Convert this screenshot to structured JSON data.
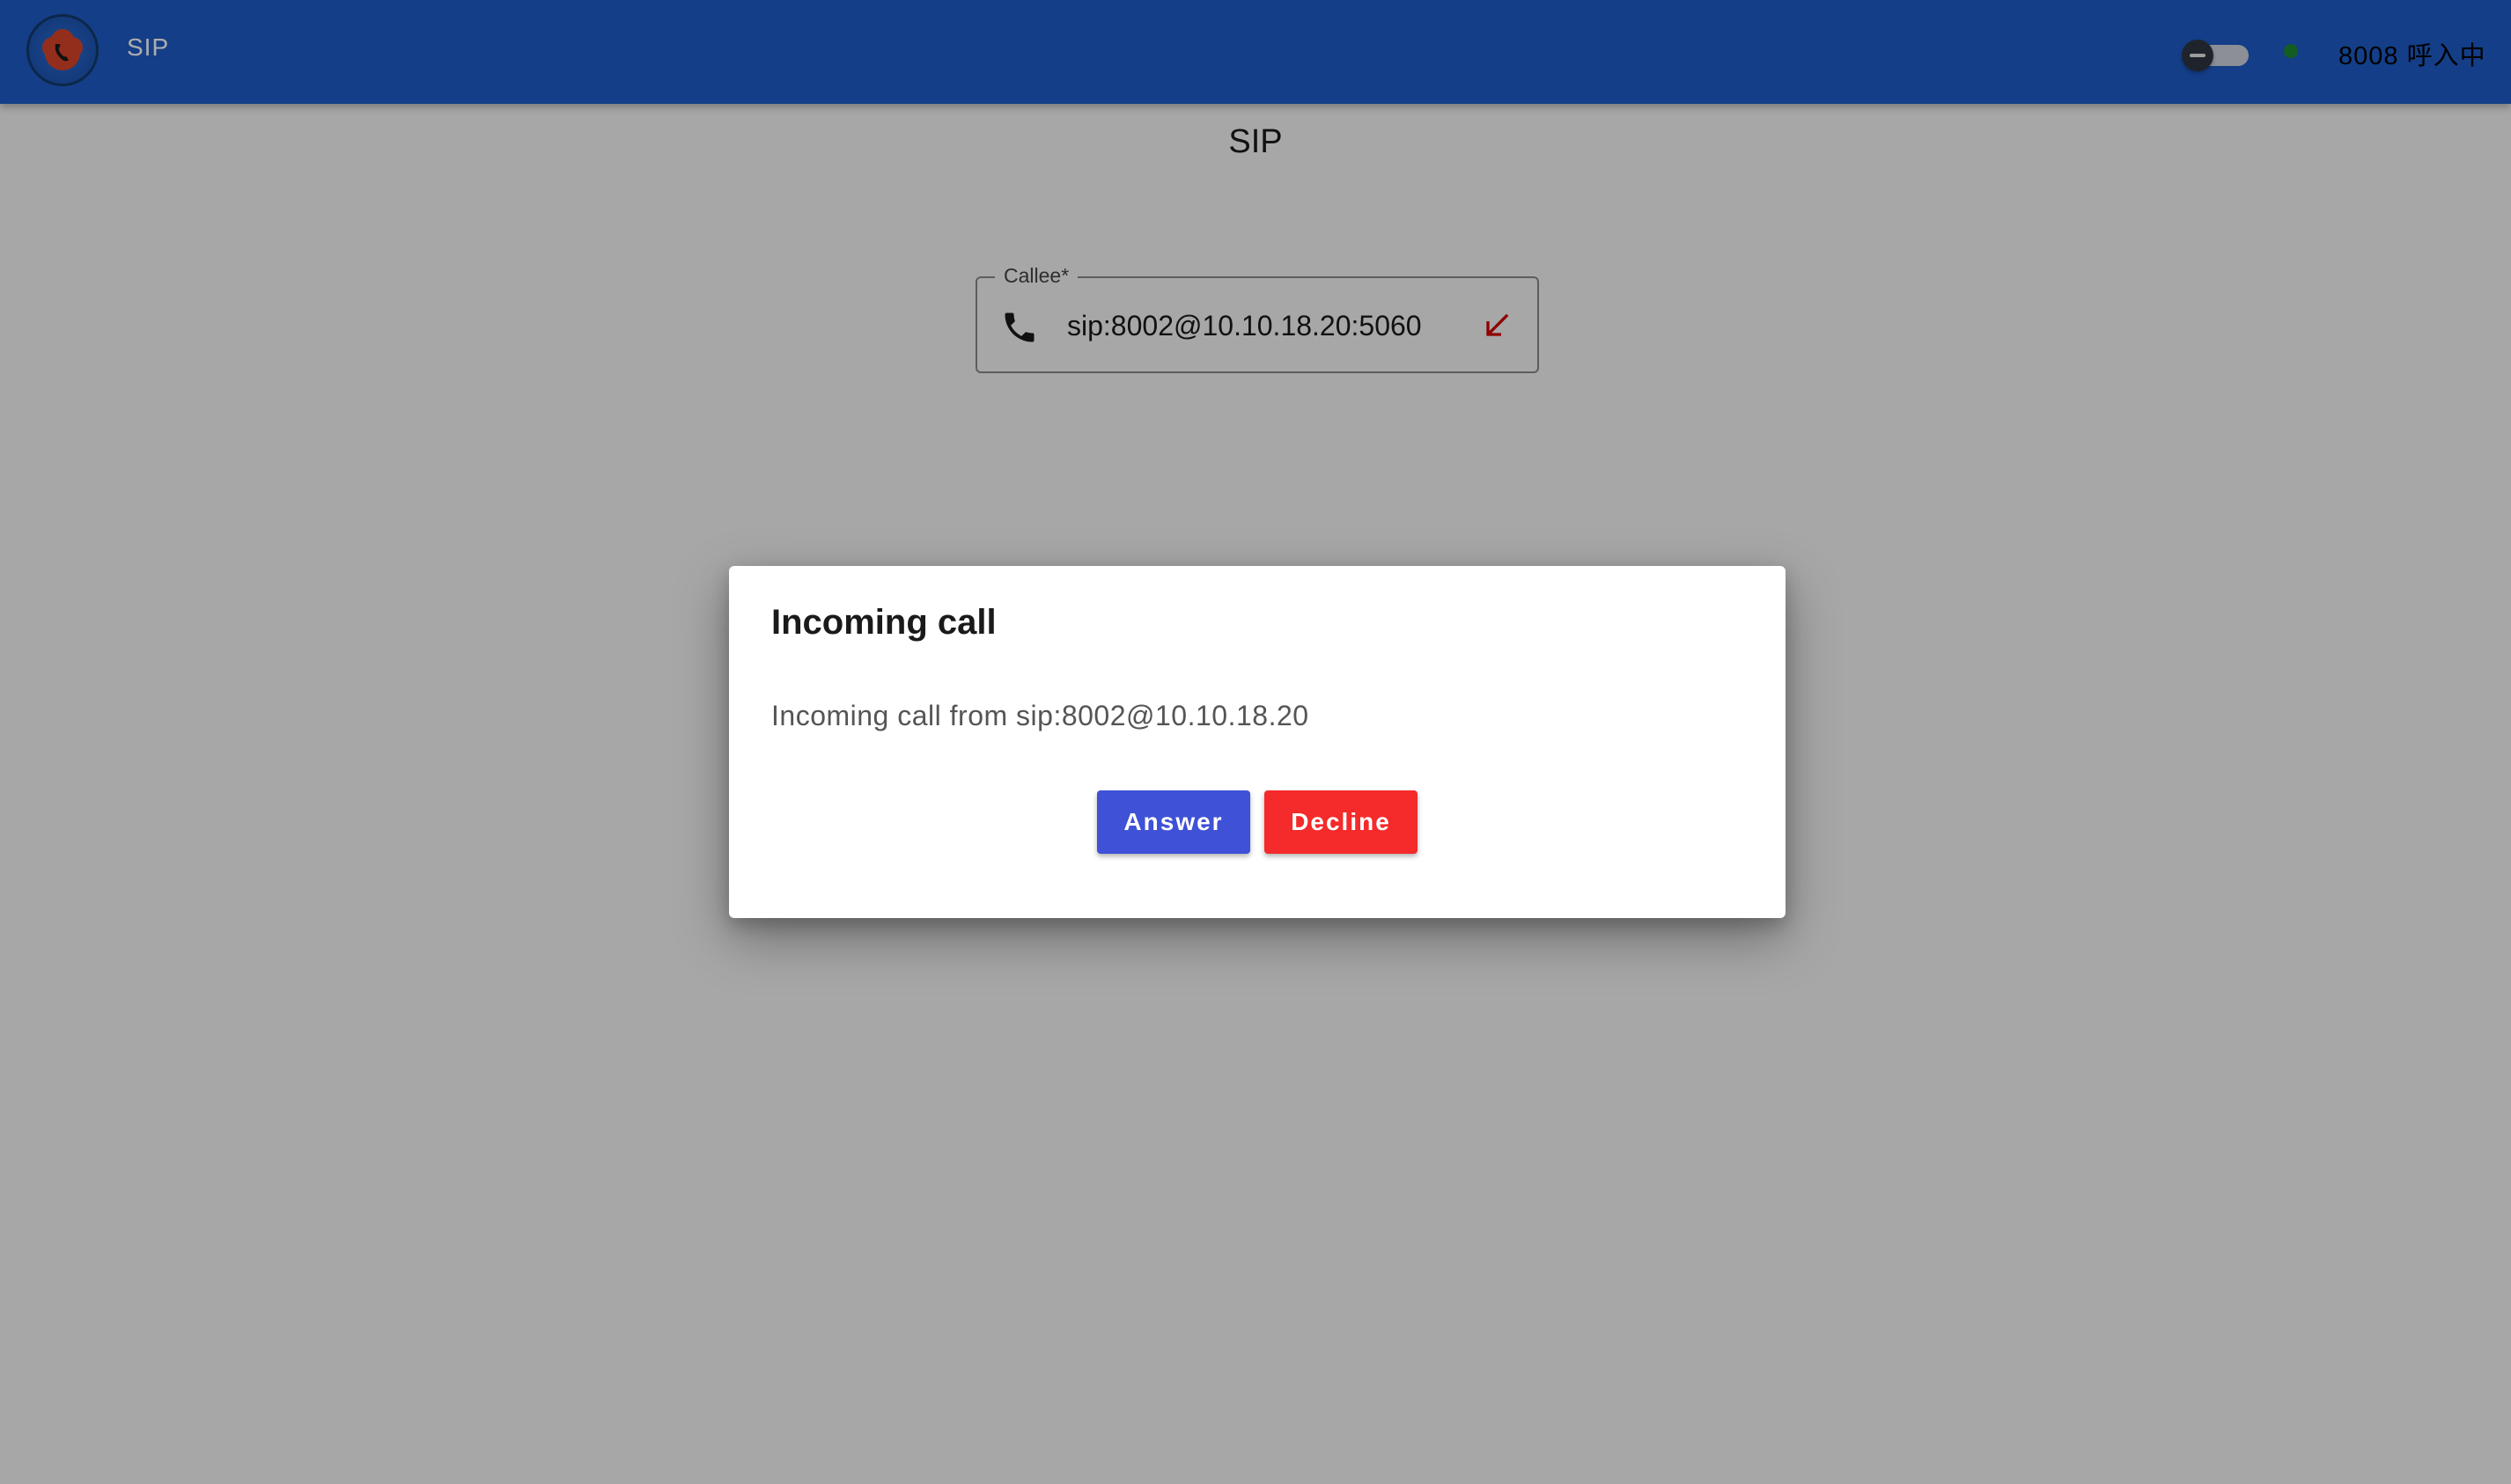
{
  "app": {
    "title": "SIP",
    "status_text": "8008 呼入中",
    "status_color": "#1c8a33",
    "appbar_color": "#1e5cc8",
    "logo_icon": "cloud-phone-logo"
  },
  "page": {
    "heading": "SIP"
  },
  "callee": {
    "label": "Callee*",
    "value": "sip:8002@10.10.18.20:5060",
    "leading_icon": "phone-icon",
    "trailing_icon": "incoming-call-arrow-icon"
  },
  "dialog": {
    "title": "Incoming call",
    "message": "Incoming call from sip:8002@10.10.18.20",
    "answer_label": "Answer",
    "decline_label": "Decline",
    "answer_color": "#3f51d6",
    "decline_color": "#f52a2a"
  },
  "theme_toggle": {
    "icon": "theme-toggle-switch",
    "checked": false
  }
}
